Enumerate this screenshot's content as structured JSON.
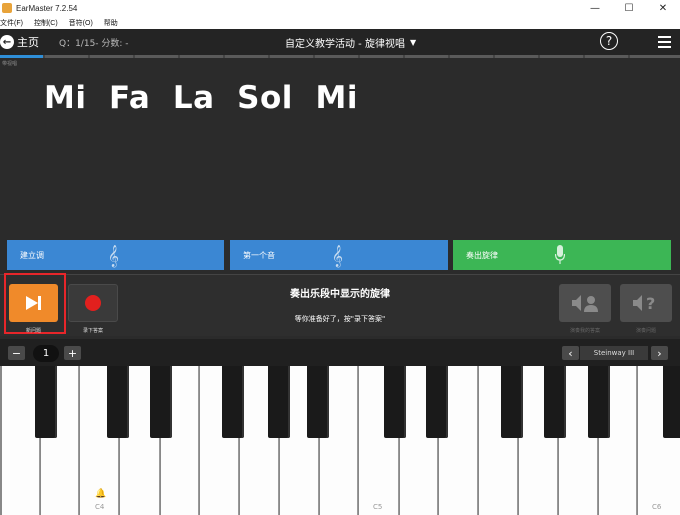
{
  "window": {
    "title": "EarMaster 7.2.54",
    "minimize": "—",
    "maximize": "☐",
    "close": "✕"
  },
  "menu": [
    "文件(F)",
    "控制(C)",
    "音符(O)",
    "帮助"
  ],
  "header": {
    "home_label": "主页",
    "question_status": "Q：1/15- 分数: -",
    "title": "自定义教学活动 - 旋律视唱",
    "help": "?"
  },
  "tiny_label": "带视唱",
  "exercise": {
    "notes": "Mi  Fa  La  Sol  Mi"
  },
  "steps": [
    {
      "label": "建立调",
      "color": "#3b87d3"
    },
    {
      "label": "第一个音",
      "color": "#3b87d3"
    },
    {
      "label": "奏出旋律",
      "color": "#3cb655"
    }
  ],
  "controls": {
    "next_label": "新问题",
    "record_label": "录下答案",
    "instruction_title": "奏出乐段中显示的旋律",
    "instruction_sub": "等你准备好了，按\"录下答案\"",
    "play_my_answer_label": "演奏我的答案",
    "play_question_label": "演奏问题"
  },
  "keyboard": {
    "minus": "−",
    "plus": "+",
    "octave": "1",
    "prev": "‹",
    "next": "›",
    "instrument": "Steinway III",
    "labels": {
      "c4": "C4",
      "c5": "C5",
      "c6": "C6"
    }
  },
  "colors": {
    "accent_blue": "#2f8fd8",
    "orange": "#f08a2a",
    "record_red": "#e2201e",
    "highlight_red": "#e8262a"
  }
}
